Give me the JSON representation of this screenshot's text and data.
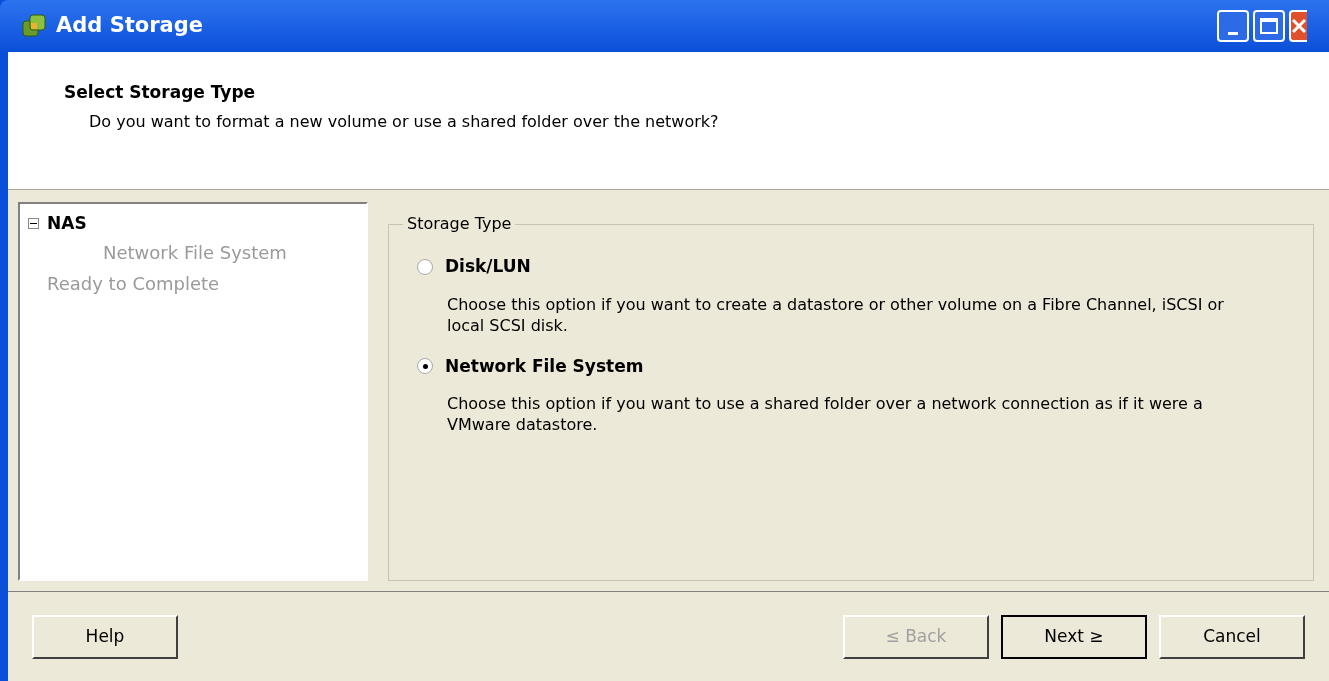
{
  "window": {
    "title": "Add Storage"
  },
  "header": {
    "title": "Select Storage Type",
    "subtitle": "Do you want to format a new volume or use a shared folder over the network?"
  },
  "steps": [
    {
      "label": "NAS",
      "expanded": true,
      "current": true,
      "children": [
        {
          "label": "Network File System",
          "current": false
        }
      ]
    },
    {
      "label": "Ready to Complete",
      "current": false
    }
  ],
  "storage_type": {
    "legend": "Storage Type",
    "options": [
      {
        "label": "Disk/LUN",
        "selected": false,
        "description": "Choose this option if you want to create a datastore or other volume on a Fibre Channel, iSCSI or local SCSI disk."
      },
      {
        "label": "Network File System",
        "selected": true,
        "description": "Choose this option if you want to use a shared folder over a network connection as if it were a VMware datastore."
      }
    ]
  },
  "buttons": [
    {
      "label": "Help",
      "kind": "left",
      "disabled": false
    },
    {
      "label": "≤ Back",
      "kind": "right",
      "disabled": true
    },
    {
      "label": "Next ≥",
      "kind": "right",
      "disabled": false,
      "default": true
    },
    {
      "label": "Cancel",
      "kind": "right",
      "disabled": false
    }
  ]
}
